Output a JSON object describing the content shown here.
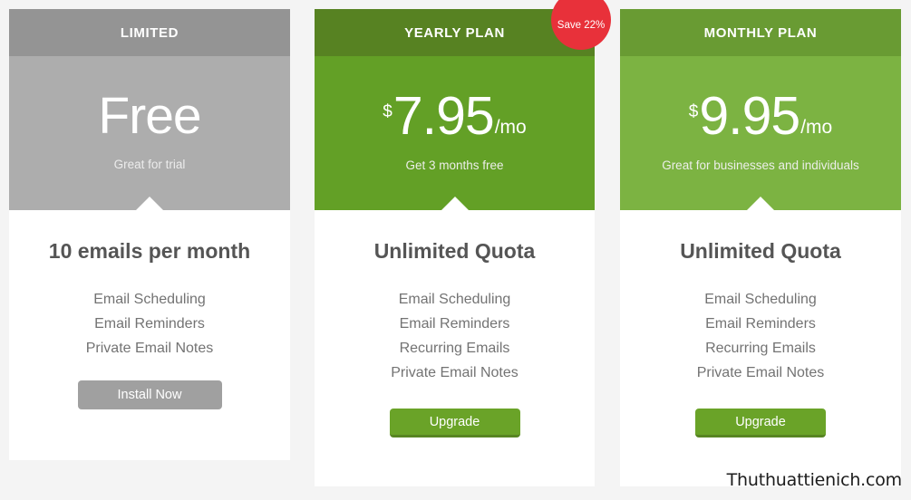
{
  "plans": [
    {
      "id": "limited",
      "title": "LIMITED",
      "price_currency": "",
      "price_amount": "Free",
      "price_period": "",
      "price_sub": "Great for trial",
      "quota": "10 emails per month",
      "features": [
        "Email Scheduling",
        "Email Reminders",
        "Private Email Notes"
      ],
      "cta_label": "Install Now",
      "head_color": "#949494",
      "band_color": "#adadad",
      "cta_color": "#a0a0a0"
    },
    {
      "id": "yearly",
      "title": "YEARLY PLAN",
      "price_currency": "$",
      "price_amount": "7.95",
      "price_period": "/mo",
      "price_sub": "Get 3 months free",
      "quota": "Unlimited Quota",
      "features": [
        "Email Scheduling",
        "Email Reminders",
        "Recurring Emails",
        "Private Email Notes"
      ],
      "cta_label": "Upgrade",
      "head_color": "#578222",
      "band_color": "#63a026",
      "cta_color": "#6aa328"
    },
    {
      "id": "monthly",
      "title": "MONTHLY PLAN",
      "price_currency": "$",
      "price_amount": "9.95",
      "price_period": "/mo",
      "price_sub": "Great for businesses and individuals",
      "quota": "Unlimited Quota",
      "features": [
        "Email Scheduling",
        "Email Reminders",
        "Recurring Emails",
        "Private Email Notes"
      ],
      "cta_label": "Upgrade",
      "head_color": "#699b33",
      "band_color": "#7cb342",
      "cta_color": "#6aa328"
    }
  ],
  "badge": {
    "label": "Save 22%",
    "color": "#e8313a"
  },
  "watermark": {
    "text": "Thuthuattienich.com"
  },
  "page": {
    "background": "#f4f4f4"
  }
}
